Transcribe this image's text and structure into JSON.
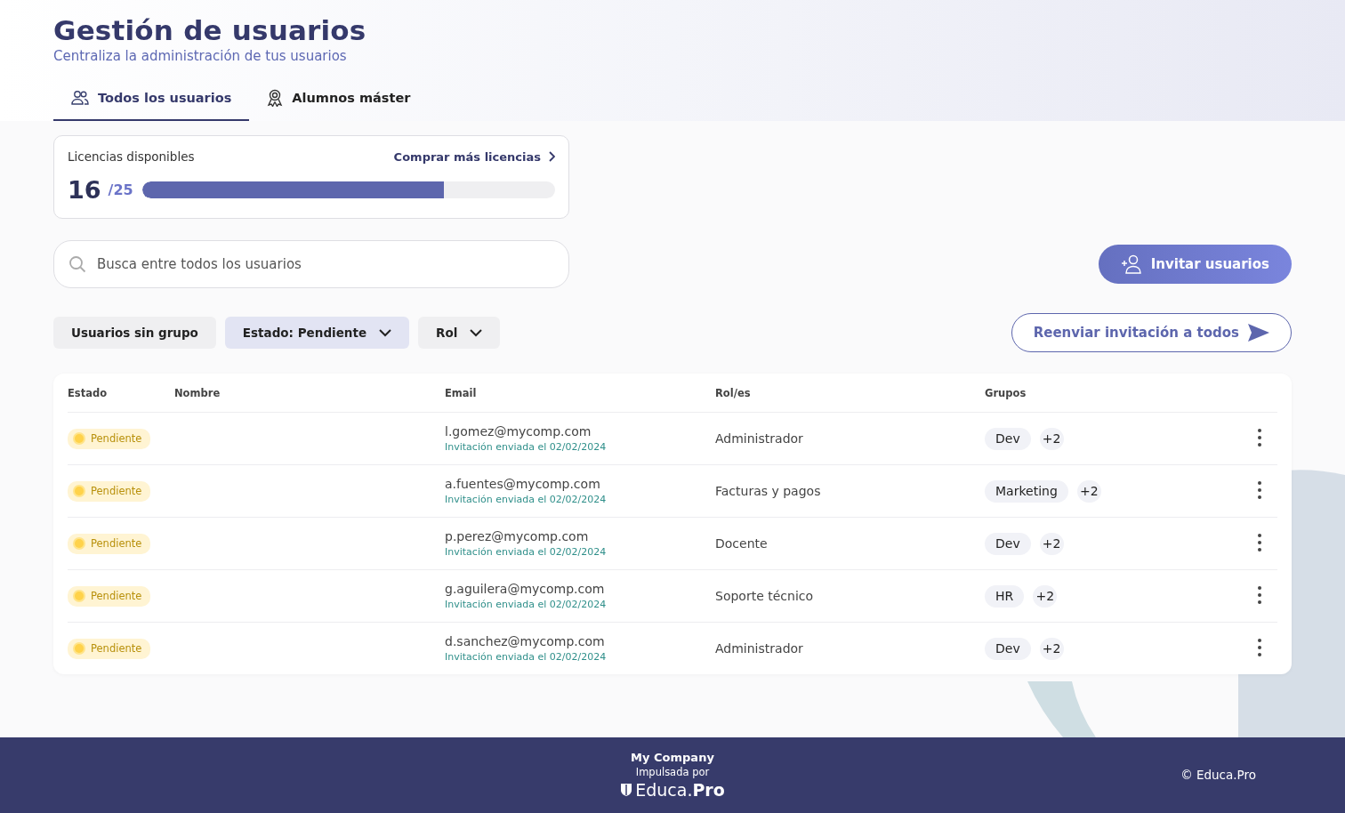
{
  "header": {
    "title": "Gestión de usuarios",
    "subtitle": "Centraliza la administración de tus usuarios"
  },
  "tabs": [
    {
      "label": "Todos los usuarios",
      "kind": "users",
      "selected": true
    },
    {
      "label": "Alumnos máster",
      "kind": "award",
      "selected": false
    }
  ],
  "licenses": {
    "label": "Licencias disponibles",
    "link": "Comprar más licencias",
    "used": "16",
    "total": "/25",
    "level": 0.73
  },
  "search": {
    "placeholder": "Busca entre todos los usuarios"
  },
  "invite_button": "Invitar usuarios",
  "filters": [
    {
      "label": "Usuarios sin grupo",
      "dropdown": false,
      "selected": false
    },
    {
      "label": "Estado: Pendiente",
      "dropdown": true,
      "selected": true
    },
    {
      "label": "Rol",
      "dropdown": true,
      "selected": false
    }
  ],
  "resend_button": "Reenviar invitación a todos",
  "table": {
    "columns": [
      "Estado",
      "Nombre",
      "Email",
      "Rol/es",
      "Grupos"
    ],
    "rows": [
      {
        "status": {
          "kind": "pending",
          "label": "Pendiente"
        },
        "email": "l.gomez@mycomp.com",
        "note": "Invitación enviada el 02/02/2024",
        "role": "Administrador",
        "groups": [
          "Dev",
          "+2"
        ]
      },
      {
        "status": {
          "kind": "pending",
          "label": "Pendiente"
        },
        "email": "a.fuentes@mycomp.com",
        "note": "Invitación enviada el 02/02/2024",
        "role": "Facturas y pagos",
        "groups": [
          "Marketing",
          "+2"
        ]
      },
      {
        "status": {
          "kind": "pending",
          "label": "Pendiente"
        },
        "email": "p.perez@mycomp.com",
        "note": "Invitación enviada el 02/02/2024",
        "role": "Docente",
        "groups": [
          "Dev",
          "+2"
        ]
      },
      {
        "status": {
          "kind": "pending",
          "label": "Pendiente"
        },
        "email": "g.aguilera@mycomp.com",
        "note": "Invitación enviada el 02/02/2024",
        "role": "Soporte técnico",
        "groups": [
          "HR",
          "+2"
        ]
      },
      {
        "status": {
          "kind": "pending",
          "label": "Pendiente"
        },
        "email": "d.sanchez@mycomp.com",
        "note": "Invitación enviada el 02/02/2024",
        "role": "Administrador",
        "groups": [
          "Dev",
          "+2"
        ]
      }
    ]
  },
  "footer": {
    "company": "My Company",
    "powered": "Impulsada por",
    "logo": "Educa.**Pro**",
    "copyright": "© Educa.Pro"
  }
}
